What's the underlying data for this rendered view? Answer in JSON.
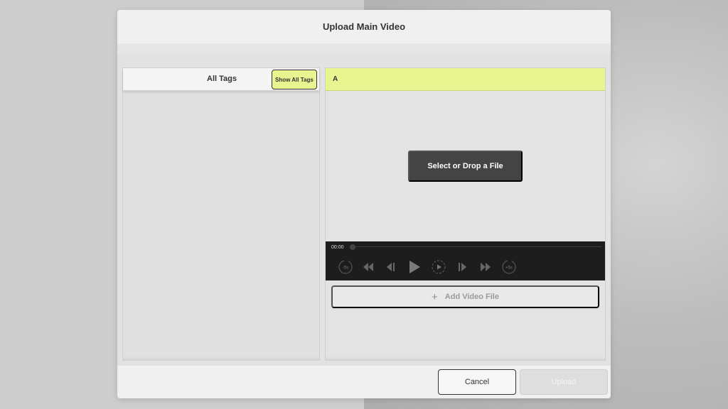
{
  "dialog": {
    "title": "Upload Main Video"
  },
  "tags_panel": {
    "title": "All Tags",
    "show_all_label": "Show All Tags",
    "accent_color": "#e7f48f"
  },
  "video_panel": {
    "label": "A",
    "drop_label": "Select or Drop a File",
    "add_file_label": "Add Video File",
    "player": {
      "time": "00:00",
      "controls": [
        {
          "name": "rewind-5s-icon",
          "label": "-5s"
        },
        {
          "name": "fast-rewind-icon"
        },
        {
          "name": "step-back-icon"
        },
        {
          "name": "play-icon"
        },
        {
          "name": "slow-play-icon"
        },
        {
          "name": "step-forward-icon"
        },
        {
          "name": "fast-forward-icon"
        },
        {
          "name": "forward-5s-icon",
          "label": "+5s"
        }
      ]
    }
  },
  "footer": {
    "cancel_label": "Cancel",
    "upload_label": "Upload"
  }
}
